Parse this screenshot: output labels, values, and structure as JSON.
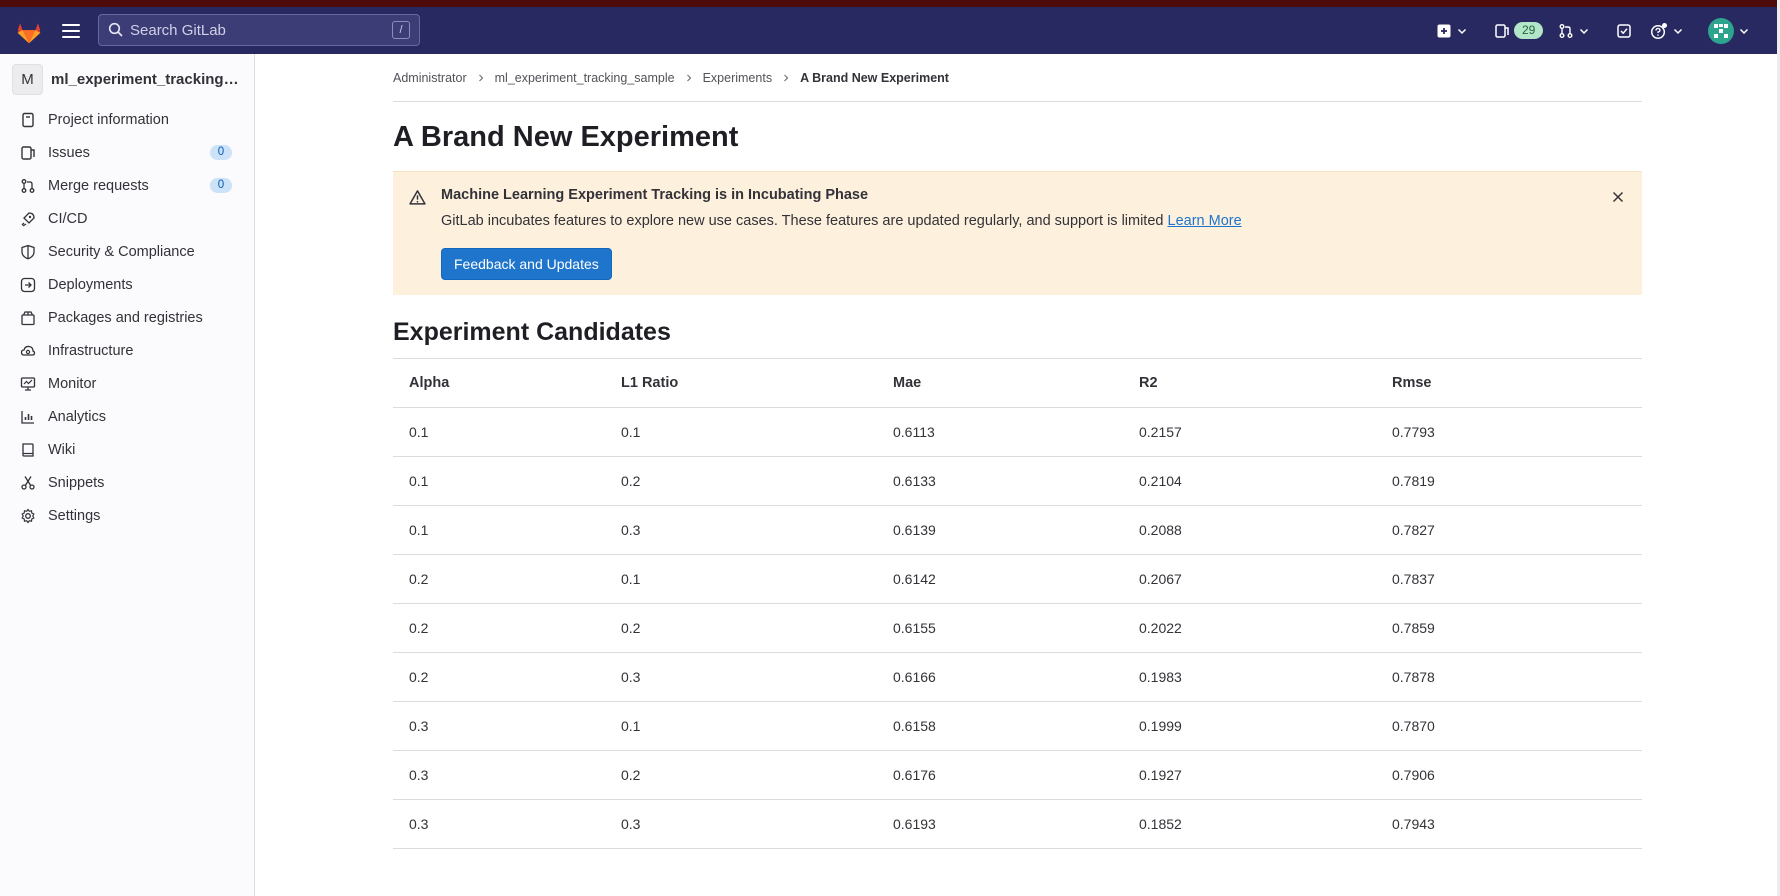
{
  "search": {
    "placeholder": "Search GitLab",
    "shortcut": "/"
  },
  "navbar": {
    "mr_count": "29"
  },
  "sidebar": {
    "project_avatar_letter": "M",
    "project_name": "ml_experiment_tracking_sample",
    "items": [
      {
        "label": "Project information",
        "icon": "project-info-icon"
      },
      {
        "label": "Issues",
        "icon": "issues-icon",
        "badge": "0"
      },
      {
        "label": "Merge requests",
        "icon": "merge-request-icon",
        "badge": "0"
      },
      {
        "label": "CI/CD",
        "icon": "rocket-icon"
      },
      {
        "label": "Security & Compliance",
        "icon": "shield-icon"
      },
      {
        "label": "Deployments",
        "icon": "deployments-icon"
      },
      {
        "label": "Packages and registries",
        "icon": "package-icon"
      },
      {
        "label": "Infrastructure",
        "icon": "cloud-gear-icon"
      },
      {
        "label": "Monitor",
        "icon": "monitor-icon"
      },
      {
        "label": "Analytics",
        "icon": "chart-icon"
      },
      {
        "label": "Wiki",
        "icon": "book-icon"
      },
      {
        "label": "Snippets",
        "icon": "scissors-icon"
      },
      {
        "label": "Settings",
        "icon": "gear-icon"
      }
    ]
  },
  "breadcrumb": [
    "Administrator",
    "ml_experiment_tracking_sample",
    "Experiments",
    "A Brand New Experiment"
  ],
  "page_title": "A Brand New Experiment",
  "alert": {
    "title": "Machine Learning Experiment Tracking is in Incubating Phase",
    "body": "GitLab incubates features to explore new use cases. These features are updated regularly, and support is limited",
    "link": "Learn More",
    "button": "Feedback and Updates"
  },
  "candidates": {
    "title": "Experiment Candidates",
    "columns": [
      "Alpha",
      "L1 Ratio",
      "Mae",
      "R2",
      "Rmse"
    ],
    "rows": [
      [
        "0.1",
        "0.1",
        "0.6113",
        "0.2157",
        "0.7793"
      ],
      [
        "0.1",
        "0.2",
        "0.6133",
        "0.2104",
        "0.7819"
      ],
      [
        "0.1",
        "0.3",
        "0.6139",
        "0.2088",
        "0.7827"
      ],
      [
        "0.2",
        "0.1",
        "0.6142",
        "0.2067",
        "0.7837"
      ],
      [
        "0.2",
        "0.2",
        "0.6155",
        "0.2022",
        "0.7859"
      ],
      [
        "0.2",
        "0.3",
        "0.6166",
        "0.1983",
        "0.7878"
      ],
      [
        "0.3",
        "0.1",
        "0.6158",
        "0.1999",
        "0.7870"
      ],
      [
        "0.3",
        "0.2",
        "0.6176",
        "0.1927",
        "0.7906"
      ],
      [
        "0.3",
        "0.3",
        "0.6193",
        "0.1852",
        "0.7943"
      ]
    ]
  },
  "colors": {
    "navbar": "#292961",
    "accent": "#1f75cb",
    "alert_bg": "#fdf1dd"
  }
}
